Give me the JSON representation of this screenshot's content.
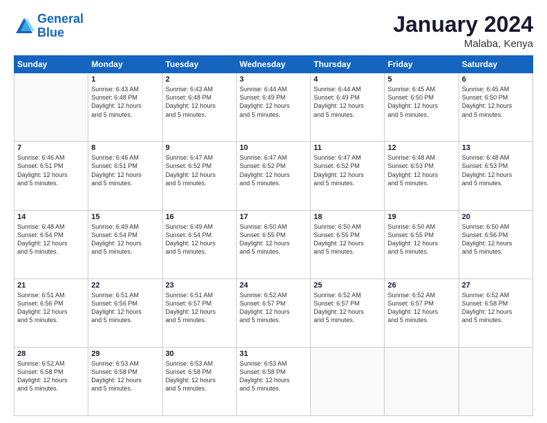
{
  "logo": {
    "line1": "General",
    "line2": "Blue"
  },
  "title": "January 2024",
  "location": "Malaba, Kenya",
  "days": [
    "Sunday",
    "Monday",
    "Tuesday",
    "Wednesday",
    "Thursday",
    "Friday",
    "Saturday"
  ],
  "weeks": [
    [
      {
        "num": "",
        "info": ""
      },
      {
        "num": "1",
        "info": "Sunrise: 6:43 AM\nSunset: 6:48 PM\nDaylight: 12 hours\nand 5 minutes."
      },
      {
        "num": "2",
        "info": "Sunrise: 6:43 AM\nSunset: 6:48 PM\nDaylight: 12 hours\nand 5 minutes."
      },
      {
        "num": "3",
        "info": "Sunrise: 6:44 AM\nSunset: 6:49 PM\nDaylight: 12 hours\nand 5 minutes."
      },
      {
        "num": "4",
        "info": "Sunrise: 6:44 AM\nSunset: 6:49 PM\nDaylight: 12 hours\nand 5 minutes."
      },
      {
        "num": "5",
        "info": "Sunrise: 6:45 AM\nSunset: 6:50 PM\nDaylight: 12 hours\nand 5 minutes."
      },
      {
        "num": "6",
        "info": "Sunrise: 6:45 AM\nSunset: 6:50 PM\nDaylight: 12 hours\nand 5 minutes."
      }
    ],
    [
      {
        "num": "7",
        "info": "Sunrise: 6:46 AM\nSunset: 6:51 PM\nDaylight: 12 hours\nand 5 minutes."
      },
      {
        "num": "8",
        "info": "Sunrise: 6:46 AM\nSunset: 6:51 PM\nDaylight: 12 hours\nand 5 minutes."
      },
      {
        "num": "9",
        "info": "Sunrise: 6:47 AM\nSunset: 6:52 PM\nDaylight: 12 hours\nand 5 minutes."
      },
      {
        "num": "10",
        "info": "Sunrise: 6:47 AM\nSunset: 6:52 PM\nDaylight: 12 hours\nand 5 minutes."
      },
      {
        "num": "11",
        "info": "Sunrise: 6:47 AM\nSunset: 6:52 PM\nDaylight: 12 hours\nand 5 minutes."
      },
      {
        "num": "12",
        "info": "Sunrise: 6:48 AM\nSunset: 6:53 PM\nDaylight: 12 hours\nand 5 minutes."
      },
      {
        "num": "13",
        "info": "Sunrise: 6:48 AM\nSunset: 6:53 PM\nDaylight: 12 hours\nand 5 minutes."
      }
    ],
    [
      {
        "num": "14",
        "info": "Sunrise: 6:48 AM\nSunset: 6:54 PM\nDaylight: 12 hours\nand 5 minutes."
      },
      {
        "num": "15",
        "info": "Sunrise: 6:49 AM\nSunset: 6:54 PM\nDaylight: 12 hours\nand 5 minutes."
      },
      {
        "num": "16",
        "info": "Sunrise: 6:49 AM\nSunset: 6:54 PM\nDaylight: 12 hours\nand 5 minutes."
      },
      {
        "num": "17",
        "info": "Sunrise: 6:50 AM\nSunset: 6:55 PM\nDaylight: 12 hours\nand 5 minutes."
      },
      {
        "num": "18",
        "info": "Sunrise: 6:50 AM\nSunset: 6:55 PM\nDaylight: 12 hours\nand 5 minutes."
      },
      {
        "num": "19",
        "info": "Sunrise: 6:50 AM\nSunset: 6:55 PM\nDaylight: 12 hours\nand 5 minutes."
      },
      {
        "num": "20",
        "info": "Sunrise: 6:50 AM\nSunset: 6:56 PM\nDaylight: 12 hours\nand 5 minutes."
      }
    ],
    [
      {
        "num": "21",
        "info": "Sunrise: 6:51 AM\nSunset: 6:56 PM\nDaylight: 12 hours\nand 5 minutes."
      },
      {
        "num": "22",
        "info": "Sunrise: 6:51 AM\nSunset: 6:56 PM\nDaylight: 12 hours\nand 5 minutes."
      },
      {
        "num": "23",
        "info": "Sunrise: 6:51 AM\nSunset: 6:57 PM\nDaylight: 12 hours\nand 5 minutes."
      },
      {
        "num": "24",
        "info": "Sunrise: 6:52 AM\nSunset: 6:57 PM\nDaylight: 12 hours\nand 5 minutes."
      },
      {
        "num": "25",
        "info": "Sunrise: 6:52 AM\nSunset: 6:57 PM\nDaylight: 12 hours\nand 5 minutes."
      },
      {
        "num": "26",
        "info": "Sunrise: 6:52 AM\nSunset: 6:57 PM\nDaylight: 12 hours\nand 5 minutes."
      },
      {
        "num": "27",
        "info": "Sunrise: 6:52 AM\nSunset: 6:58 PM\nDaylight: 12 hours\nand 5 minutes."
      }
    ],
    [
      {
        "num": "28",
        "info": "Sunrise: 6:52 AM\nSunset: 6:58 PM\nDaylight: 12 hours\nand 5 minutes."
      },
      {
        "num": "29",
        "info": "Sunrise: 6:53 AM\nSunset: 6:58 PM\nDaylight: 12 hours\nand 5 minutes."
      },
      {
        "num": "30",
        "info": "Sunrise: 6:53 AM\nSunset: 6:58 PM\nDaylight: 12 hours\nand 5 minutes."
      },
      {
        "num": "31",
        "info": "Sunrise: 6:53 AM\nSunset: 6:58 PM\nDaylight: 12 hours\nand 5 minutes."
      },
      {
        "num": "",
        "info": ""
      },
      {
        "num": "",
        "info": ""
      },
      {
        "num": "",
        "info": ""
      }
    ]
  ]
}
